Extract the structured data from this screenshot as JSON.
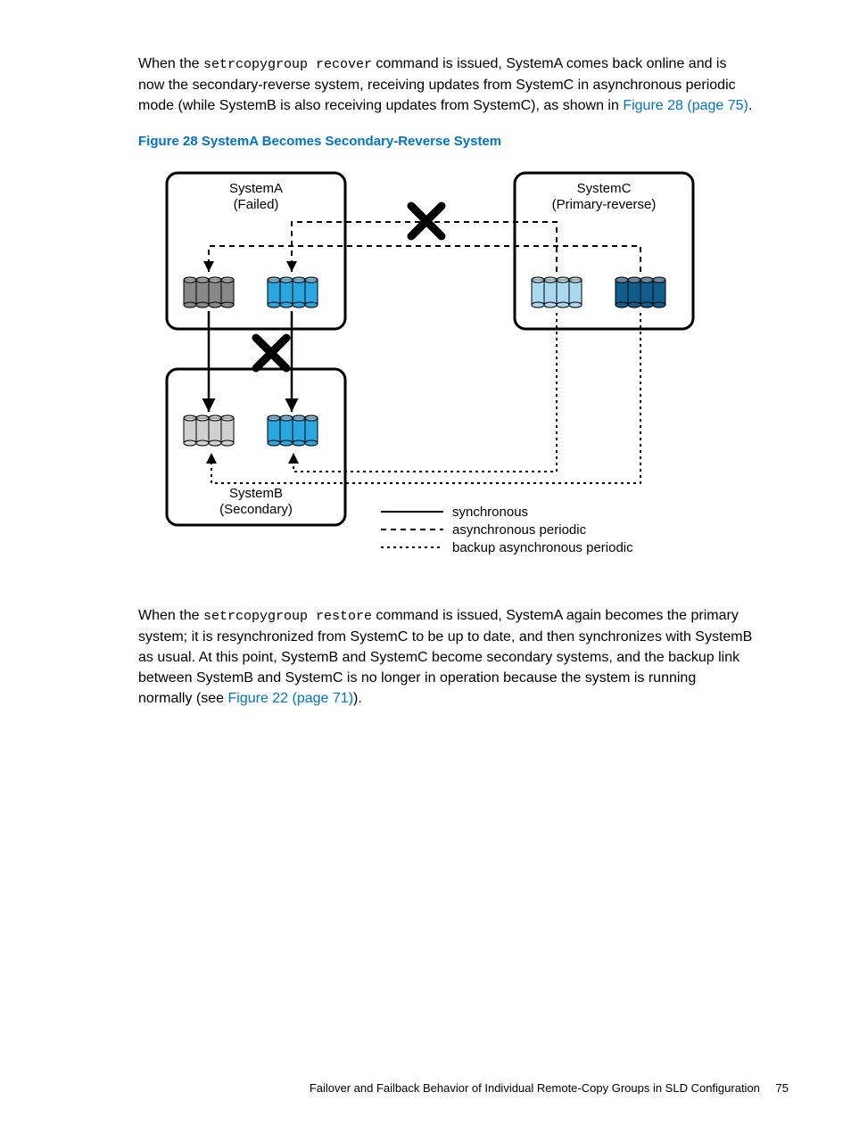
{
  "para1": {
    "pre": "When the ",
    "code": "setrcopygroup recover",
    "mid": " command is issued, SystemA comes back online and is now the secondary-reverse system, receiving updates from SystemC in asynchronous periodic mode (while SystemB is also receiving updates from SystemC), as shown in ",
    "link": "Figure 28 (page 75)",
    "post": "."
  },
  "figureCaption": "Figure 28 SystemA Becomes Secondary-Reverse System",
  "diagram": {
    "systemA": {
      "line1": "SystemA",
      "line2": "(Failed)"
    },
    "systemB": {
      "line1": "SystemB",
      "line2": "(Secondary)"
    },
    "systemC": {
      "line1": "SystemC",
      "line2": "(Primary-reverse)"
    },
    "legend": {
      "l1": "synchronous",
      "l2": "asynchronous periodic",
      "l3": "backup asynchronous periodic"
    }
  },
  "para2": {
    "pre": "When the ",
    "code": "setrcopygroup restore",
    "mid": " command is issued, SystemA again becomes the primary system; it is resynchronized from SystemC to be up to date, and then synchronizes with SystemB as usual. At this point, SystemB and SystemC become secondary systems, and the backup link between SystemB and SystemC is no longer in operation because the system is running normally (see ",
    "link": "Figure 22 (page 71)",
    "post": ")."
  },
  "footer": {
    "text": "Failover and Failback Behavior of Individual Remote-Copy Groups in SLD Configuration",
    "page": "75"
  }
}
